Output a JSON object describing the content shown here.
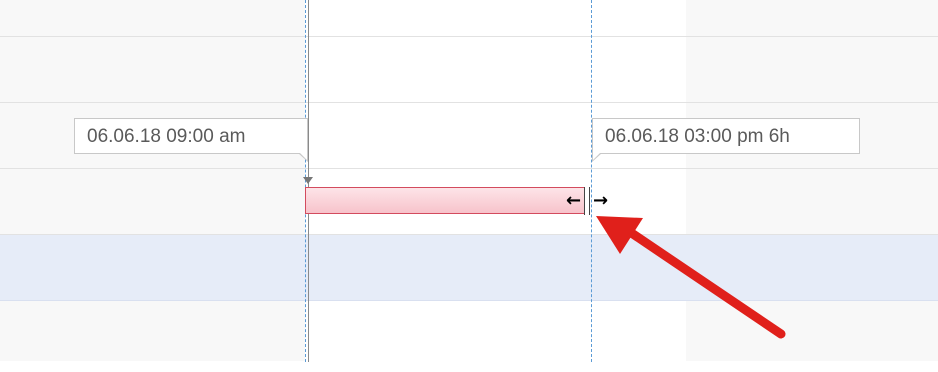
{
  "timeline": {
    "start_tooltip": "06.06.18 09:00 am",
    "end_tooltip": "06.06.18 03:00 pm 6h"
  },
  "task": {
    "bar_color": "#f7c3cb",
    "border_color": "#d34b5e"
  },
  "cursor": {
    "left_arrow": "←",
    "right_arrow": "→"
  },
  "annotation": {
    "arrow_color": "#e0201b"
  },
  "colors": {
    "guide_line": "#5b9bd5",
    "selected_row": "#e6ecf8"
  }
}
